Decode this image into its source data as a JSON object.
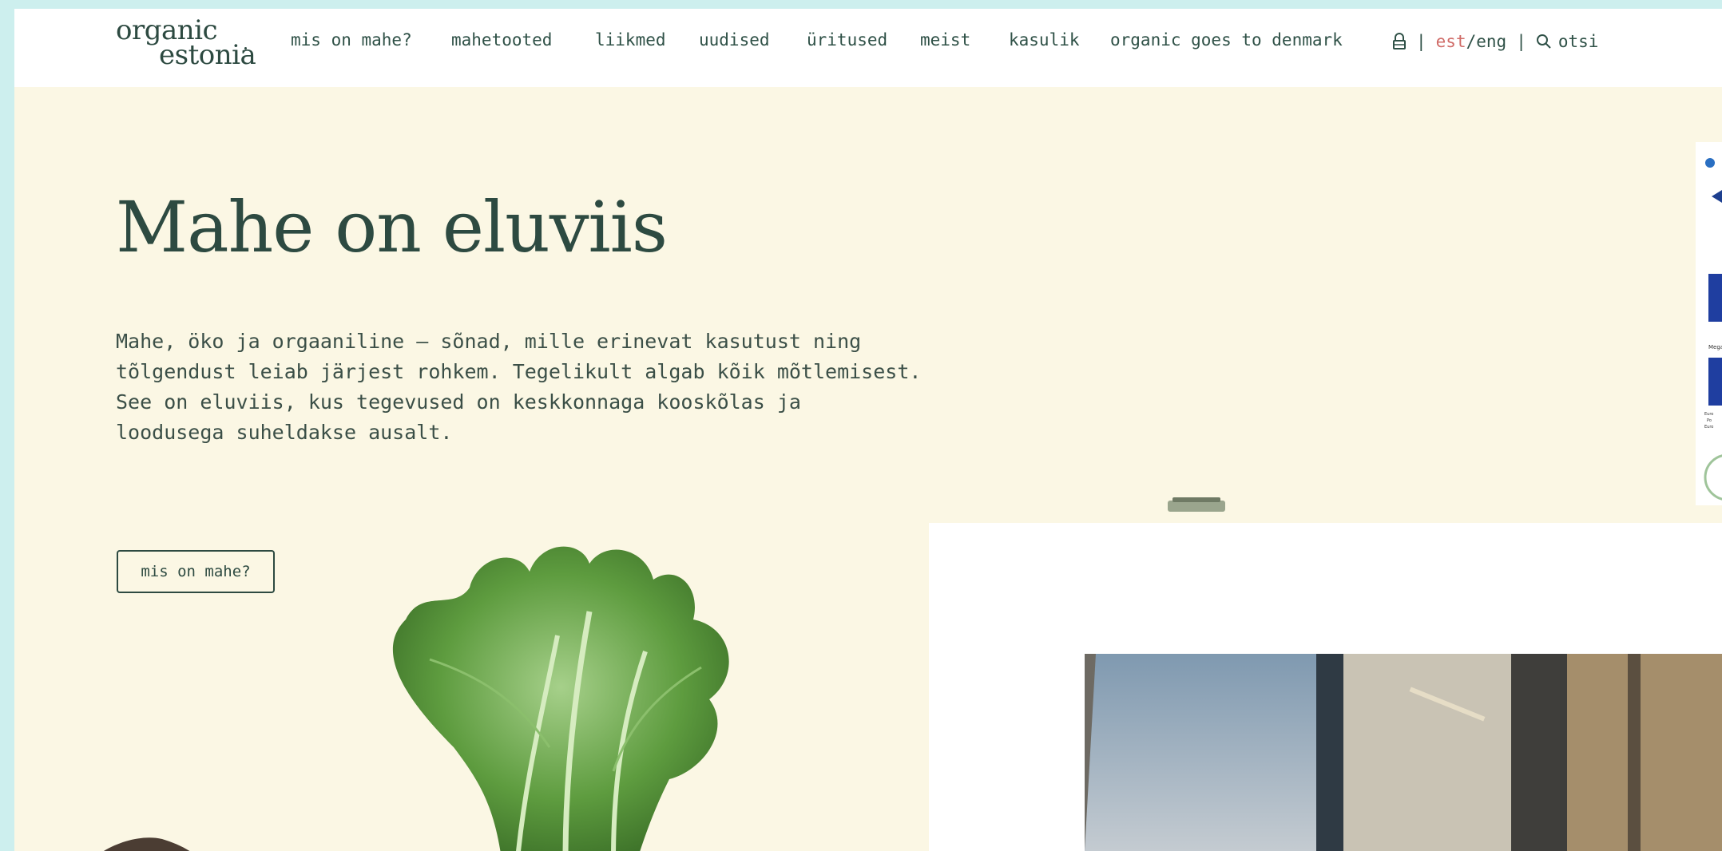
{
  "logo": {
    "line1": "organic",
    "line2": "estonia"
  },
  "nav": {
    "items": [
      {
        "label": "mis on mahe?"
      },
      {
        "label": "mahetooted"
      },
      {
        "label": "liikmed"
      },
      {
        "label": "uudised"
      },
      {
        "label": "üritused"
      },
      {
        "label": "meist"
      },
      {
        "label": "kasulik"
      },
      {
        "label": "organic goes to denmark"
      }
    ]
  },
  "tools": {
    "lock_icon": "lock-icon",
    "separator": "|",
    "lang_est": "est",
    "lang_slash": "/",
    "lang_eng": "eng",
    "search_icon": "search-icon",
    "search_label": "otsi",
    "active_color": "#d06c68"
  },
  "hero": {
    "title": "Mahe on eluviis",
    "text_lines": [
      "Mahe, öko ja orgaaniline – sõnad, mille erinevat kasutust ning",
      "tõlgendust leiab järjest rohkem. Tegelikult algab kõik mõtlemisest.",
      "See on eluviis, kus tegevused on keskkonnaga kooskõlas ja",
      "loodusega suheldakse ausalt."
    ],
    "button_label": "mis on mahe?"
  },
  "colors": {
    "frame": "#cdefee",
    "page_bg": "#fbf7e4",
    "header_bg": "#ffffff",
    "brand_green": "#2d4a41"
  }
}
